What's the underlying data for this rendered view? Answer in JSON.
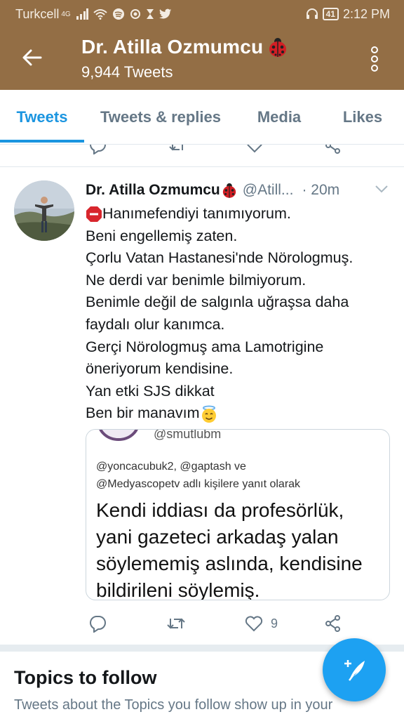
{
  "status_bar": {
    "carrier": "Turkcell",
    "network": "4G",
    "battery": "41",
    "time": "2:12 PM"
  },
  "header": {
    "title": "Dr. Atilla Ozmumcu",
    "tweet_count": "9,944 Tweets",
    "background_color": "#936e45"
  },
  "tabs": [
    {
      "label": "Tweets",
      "active": true
    },
    {
      "label": "Tweets & replies",
      "active": false
    },
    {
      "label": "Media",
      "active": false
    },
    {
      "label": "Likes",
      "active": false
    }
  ],
  "tweet": {
    "author": "Dr. Atilla Ozmumcu",
    "handle": "@Atill...",
    "time": "· 20m",
    "lines": [
      "Hanımefendiyi tanımıyorum.",
      "Beni engellemiş zaten.",
      "Çorlu Vatan Hastanesi'nde Nörologmuş.",
      "Ne derdi var benimle  bilmiyorum.",
      "Benimle değil de salgınla uğraşsa daha",
      "faydalı olur kanımca.",
      "Gerçi Nörologmuş ama Lamotrigine",
      "öneriyorum kendisine.",
      "Yan etki SJS dikkat",
      "Ben bir manavım"
    ],
    "quote": {
      "handle": "@smutlubm",
      "reply_line_1": "@yoncacubuk2, @gaptash ve",
      "reply_line_2": "@Medyascopetv adlı kişilere yanıt olarak",
      "text_lines": [
        "Kendi iddiası da profesörlük,",
        "yani gazeteci arkadaş yalan",
        "söylememiş aslında, kendisine",
        "bildirileni söylemiş."
      ]
    },
    "like_count": "9"
  },
  "topics": {
    "title": "Topics to follow",
    "subtitle": "Tweets about the Topics you follow show up in your"
  },
  "accent_color": "#1b95e0"
}
